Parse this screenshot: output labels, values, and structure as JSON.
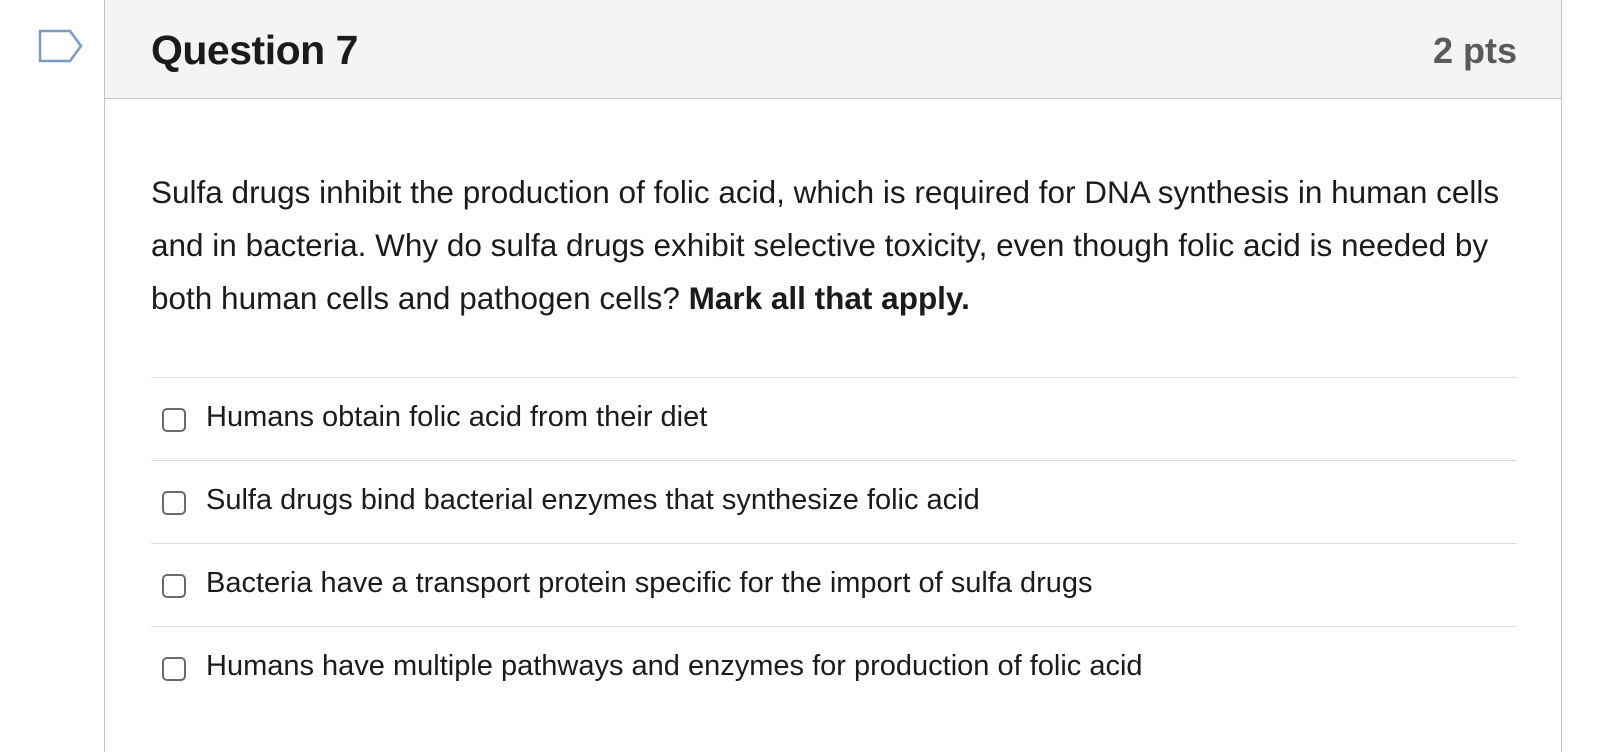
{
  "question": {
    "title": "Question 7",
    "points": "2 pts",
    "prompt_text": "Sulfa drugs inhibit the production of folic acid, which is required for DNA synthesis in human cells and in bacteria. Why do sulfa drugs exhibit selective toxicity, even though folic acid is needed by both human cells and pathogen cells? ",
    "prompt_emphasis": "Mark all that apply."
  },
  "answers": [
    {
      "label": "Humans obtain folic acid from their diet",
      "checked": false
    },
    {
      "label": "Sulfa drugs bind bacterial enzymes that synthesize folic acid",
      "checked": false
    },
    {
      "label": "Bacteria have a transport protein specific for the import of sulfa drugs",
      "checked": false
    },
    {
      "label": "Humans have multiple pathways and enzymes for production of folic acid",
      "checked": false
    }
  ],
  "icons": {
    "flag": "flag-question-icon"
  },
  "colors": {
    "header_bg": "#f4f4f4",
    "border": "#c4c4c4",
    "flag_stroke": "#7b9cc0",
    "text": "#1b1b1b",
    "points_text": "#5a5a5a"
  }
}
